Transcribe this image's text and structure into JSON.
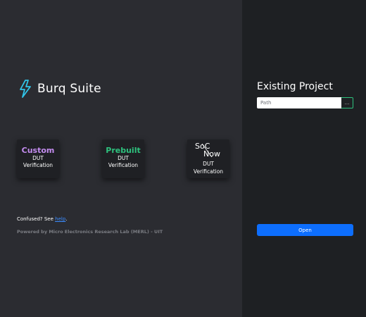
{
  "app": {
    "title": "Burq Suite"
  },
  "cards": [
    {
      "title": "Custom",
      "line1": "DUT",
      "line2": "Verification"
    },
    {
      "title": "Prebuilt",
      "line1": "DUT",
      "line2": "Verification"
    },
    {
      "title": "SoC Now",
      "logo_soc": "SoC",
      "logo_now": "Now",
      "line1": "DUT",
      "line2": "Verification"
    }
  ],
  "help": {
    "prefix": "Confused? See ",
    "link": "help",
    "suffix": "."
  },
  "footer": {
    "powered": "Powered by Micro Electronics Research Lab (MERL) - UIT"
  },
  "existing": {
    "heading": "Existing Project",
    "path_placeholder": "Path",
    "browse_label": "...",
    "open_label": "Open"
  },
  "colors": {
    "custom": "#c48df0",
    "prebuilt": "#2ec27e",
    "accent": "#0d6efd",
    "logo": "#31c4e8"
  },
  "icons": {
    "logo": "lightning-bolt-icon"
  }
}
